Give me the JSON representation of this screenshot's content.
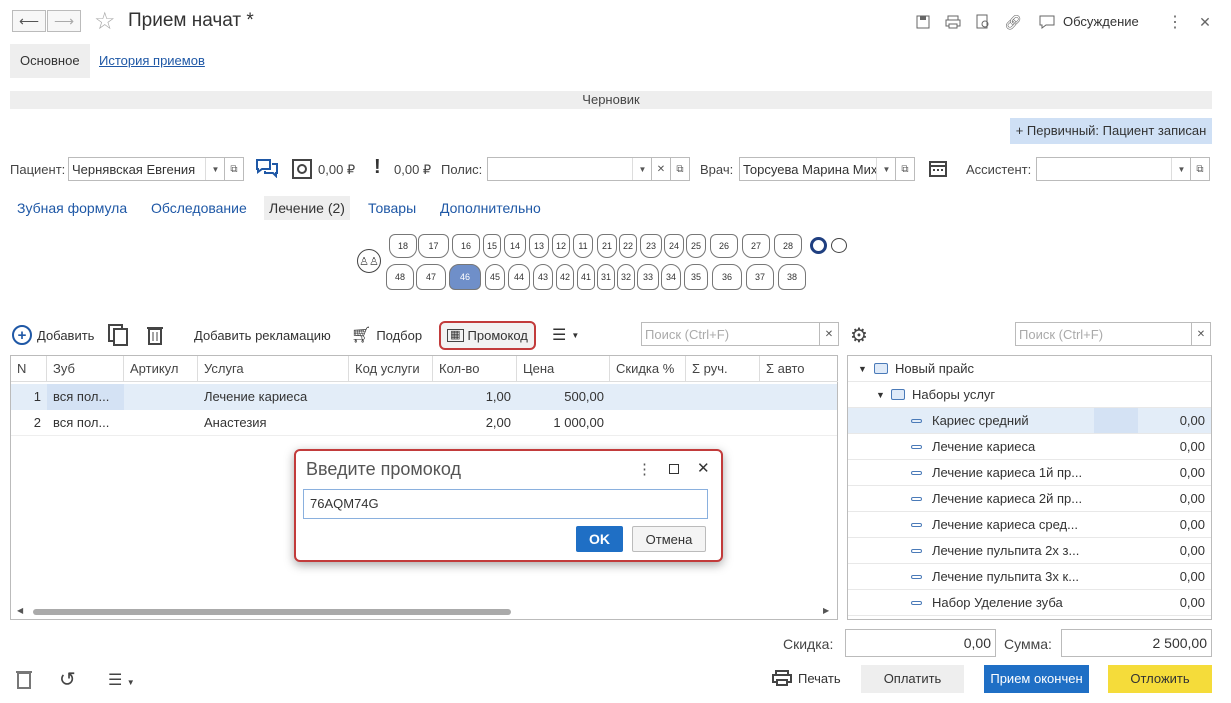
{
  "window": {
    "title": "Прием начат *",
    "discussion": "Обсуждение"
  },
  "tabs": {
    "main": "Основное",
    "history": "История приемов"
  },
  "status": "Черновик",
  "primary_badge": "+ Первичный: Пациент записан",
  "fields": {
    "patient_label": "Пациент:",
    "patient_value": "Чернявская Евгения",
    "amount1": "0,00 ₽",
    "amount2": "0,00 ₽",
    "policy_label": "Полис:",
    "policy_value": "",
    "doctor_label": "Врач:",
    "doctor_value": "Торсуева Марина Мих",
    "assistant_label": "Ассистент:",
    "assistant_value": ""
  },
  "form_tabs": [
    "Зубная формула",
    "Обследование",
    "Лечение (2)",
    "Товары",
    "Дополнительно"
  ],
  "teeth_upper": [
    "18",
    "17",
    "16",
    "15",
    "14",
    "13",
    "12",
    "11",
    "21",
    "22",
    "23",
    "24",
    "25",
    "26",
    "27",
    "28"
  ],
  "teeth_lower": [
    "48",
    "47",
    "46",
    "45",
    "44",
    "43",
    "42",
    "41",
    "31",
    "32",
    "33",
    "34",
    "35",
    "36",
    "37",
    "38"
  ],
  "toolbar": {
    "add": "Добавить",
    "add_claim": "Добавить рекламацию",
    "selection": "Подбор",
    "promo": "Промокод",
    "search_placeholder": "Поиск (Ctrl+F)"
  },
  "table": {
    "headers": [
      "N",
      "Зуб",
      "Артикул",
      "Услуга",
      "Код услуги",
      "Кол-во",
      "Цена",
      "Скидка %",
      "Σ руч.",
      "Σ авто"
    ],
    "rows": [
      {
        "n": "1",
        "tooth": "вся пол...",
        "article": "",
        "service": "Лечение кариеса",
        "code": "",
        "qty": "1,00",
        "price": "500,00"
      },
      {
        "n": "2",
        "tooth": "вся пол...",
        "article": "",
        "service": "Анастезия",
        "code": "",
        "qty": "2,00",
        "price": "1 000,00"
      }
    ]
  },
  "tree": {
    "search_placeholder": "Поиск (Ctrl+F)",
    "root": "Новый прайс",
    "group": "Наборы услуг",
    "items": [
      {
        "name": "Кариес средний",
        "value": "0,00"
      },
      {
        "name": "Лечение кариеса",
        "value": "0,00"
      },
      {
        "name": "Лечение кариеса 1й пр...",
        "value": "0,00"
      },
      {
        "name": "Лечение кариеса 2й пр...",
        "value": "0,00"
      },
      {
        "name": "Лечение кариеса сред...",
        "value": "0,00"
      },
      {
        "name": "Лечение пульпита 2х з...",
        "value": "0,00"
      },
      {
        "name": "Лечение пульпита 3х к...",
        "value": "0,00"
      },
      {
        "name": "Набор Уделение зуба",
        "value": "0,00"
      }
    ]
  },
  "totals": {
    "discount_label": "Скидка:",
    "discount_value": "0,00",
    "sum_label": "Сумма:",
    "sum_value": "2 500,00"
  },
  "footer": {
    "print": "Печать",
    "pay": "Оплатить",
    "finish": "Прием окончен",
    "postpone": "Отложить"
  },
  "dialog": {
    "title": "Введите промокод",
    "value": "76AQM74G",
    "ok": "OK",
    "cancel": "Отмена"
  },
  "colors": {
    "link": "#1f58a6",
    "accent": "#1f6fc5",
    "highlight_row": "#e3edf8",
    "postpone": "#f5dc3a",
    "badge": "#cfe0f5"
  }
}
